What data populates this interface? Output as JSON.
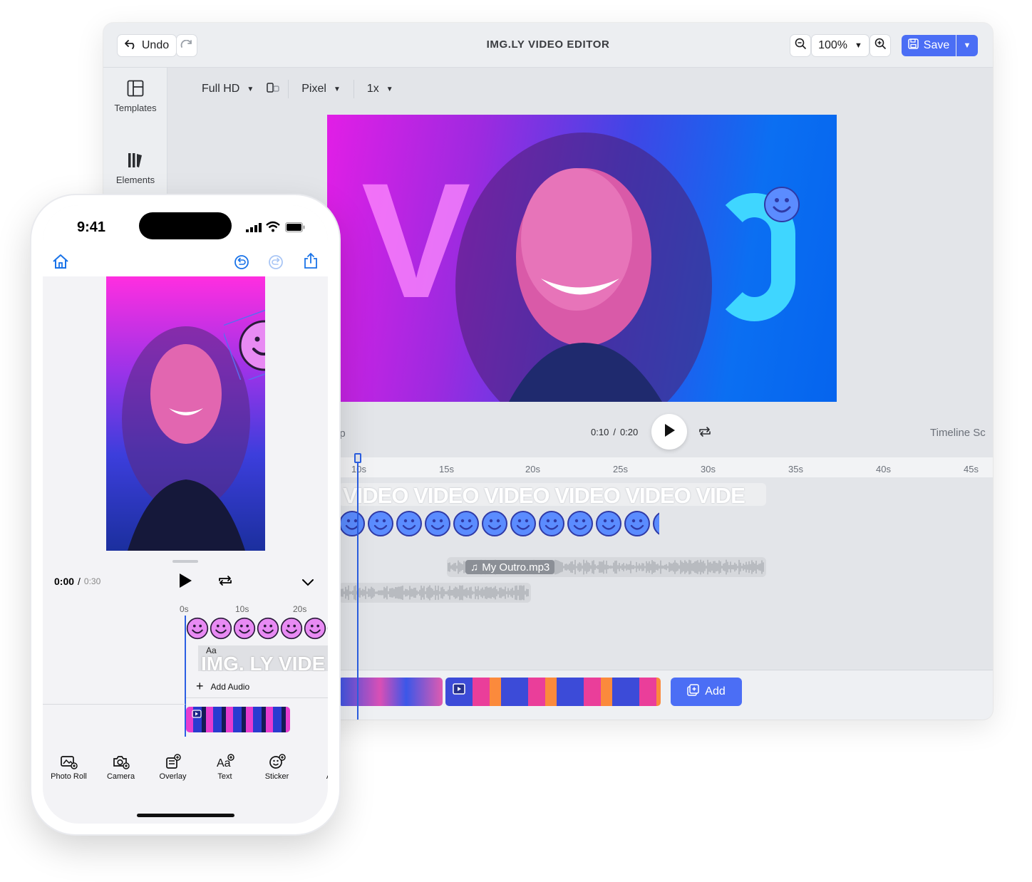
{
  "desktop": {
    "title": "IMG.LY VIDEO EDITOR",
    "undo_label": "Undo",
    "zoom_value": "100%",
    "save_label": "Save",
    "sidebar": [
      {
        "label": "Templates",
        "icon": "templates-icon"
      },
      {
        "label": "Elements",
        "icon": "elements-icon"
      }
    ],
    "toolbar": {
      "resolution": "Full HD",
      "unit": "Pixel",
      "scale": "1x"
    },
    "canvas_text": "V",
    "player": {
      "clip_label": "ip",
      "current_time": "0:10",
      "separator": "/",
      "duration": "0:20",
      "timeline_scale_label": "Timeline Sc"
    },
    "ruler_ticks": [
      "10s",
      "15s",
      "20s",
      "25s",
      "30s",
      "35s",
      "40s",
      "45s"
    ],
    "text_track": "VIDEO  VIDEO  VIDEO  VIDEO  VIDEO  VIDE",
    "audio_track_label": "My Outro.mp3",
    "add_label": "Add",
    "accent_color": "#4b6ef5"
  },
  "phone": {
    "clock": "9:41",
    "current_time": "0:00",
    "separator": "/",
    "duration": "0:30",
    "ruler_ticks": [
      "0s",
      "10s",
      "20s"
    ],
    "text_track_icon": "Aa",
    "text_track": "IMG. LY VIDE",
    "add_audio_label": "Add Audio",
    "tools": [
      {
        "label": "Photo Roll",
        "icon": "photo-roll-icon"
      },
      {
        "label": "Camera",
        "icon": "camera-icon"
      },
      {
        "label": "Overlay",
        "icon": "overlay-icon"
      },
      {
        "label": "Text",
        "icon": "text-icon"
      },
      {
        "label": "Sticker",
        "icon": "sticker-icon"
      },
      {
        "label": "A",
        "icon": "more-tool-icon"
      }
    ]
  }
}
